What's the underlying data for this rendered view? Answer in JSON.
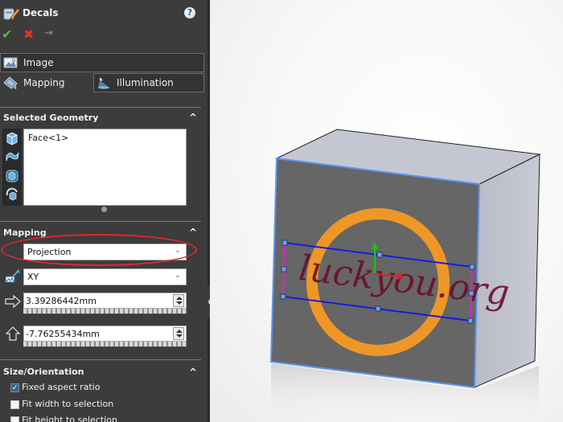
{
  "panel": {
    "title": "Decals",
    "help_icon": "?",
    "actions": {
      "ok_icon": "✔",
      "cancel_icon": "✖",
      "pin_icon": "⇥"
    },
    "tabs": [
      {
        "label": "Image",
        "icon": "image-icon"
      },
      {
        "label": "Mapping",
        "icon": "mapping-icon",
        "active": true
      },
      {
        "label": "Illumination",
        "icon": "illumination-icon"
      }
    ],
    "selected_geometry": {
      "title": "Selected Geometry",
      "items": [
        "Face<1>"
      ]
    },
    "mapping": {
      "title": "Mapping",
      "mapping_type": "Projection",
      "projection_direction": "XY",
      "horizontal_location": "3.39286442mm",
      "vertical_location": "-7.76255434mm"
    },
    "size_orientation": {
      "title": "Size/Orientation",
      "options": [
        {
          "label": "Fixed aspect ratio",
          "checked": true
        },
        {
          "label": "Fit width to selection",
          "checked": false
        },
        {
          "label": "Fit height to selection",
          "checked": false
        }
      ]
    },
    "collapse_glyph": "^"
  },
  "viewport": {
    "decal_text": "luckyou.org",
    "colors": {
      "front_face": "#666666",
      "top_face": "#c3c6d0",
      "side_face": "#b4b6c2",
      "ring": "#f59a24",
      "decal_text": "#6b0f2a",
      "frame_blue": "#1a1adf",
      "frame_magenta": "#e020c0",
      "selection_edge": "#5a96f0",
      "handle": "#6fa0e8",
      "axis_x": "#e02020",
      "axis_y": "#20c020"
    }
  }
}
